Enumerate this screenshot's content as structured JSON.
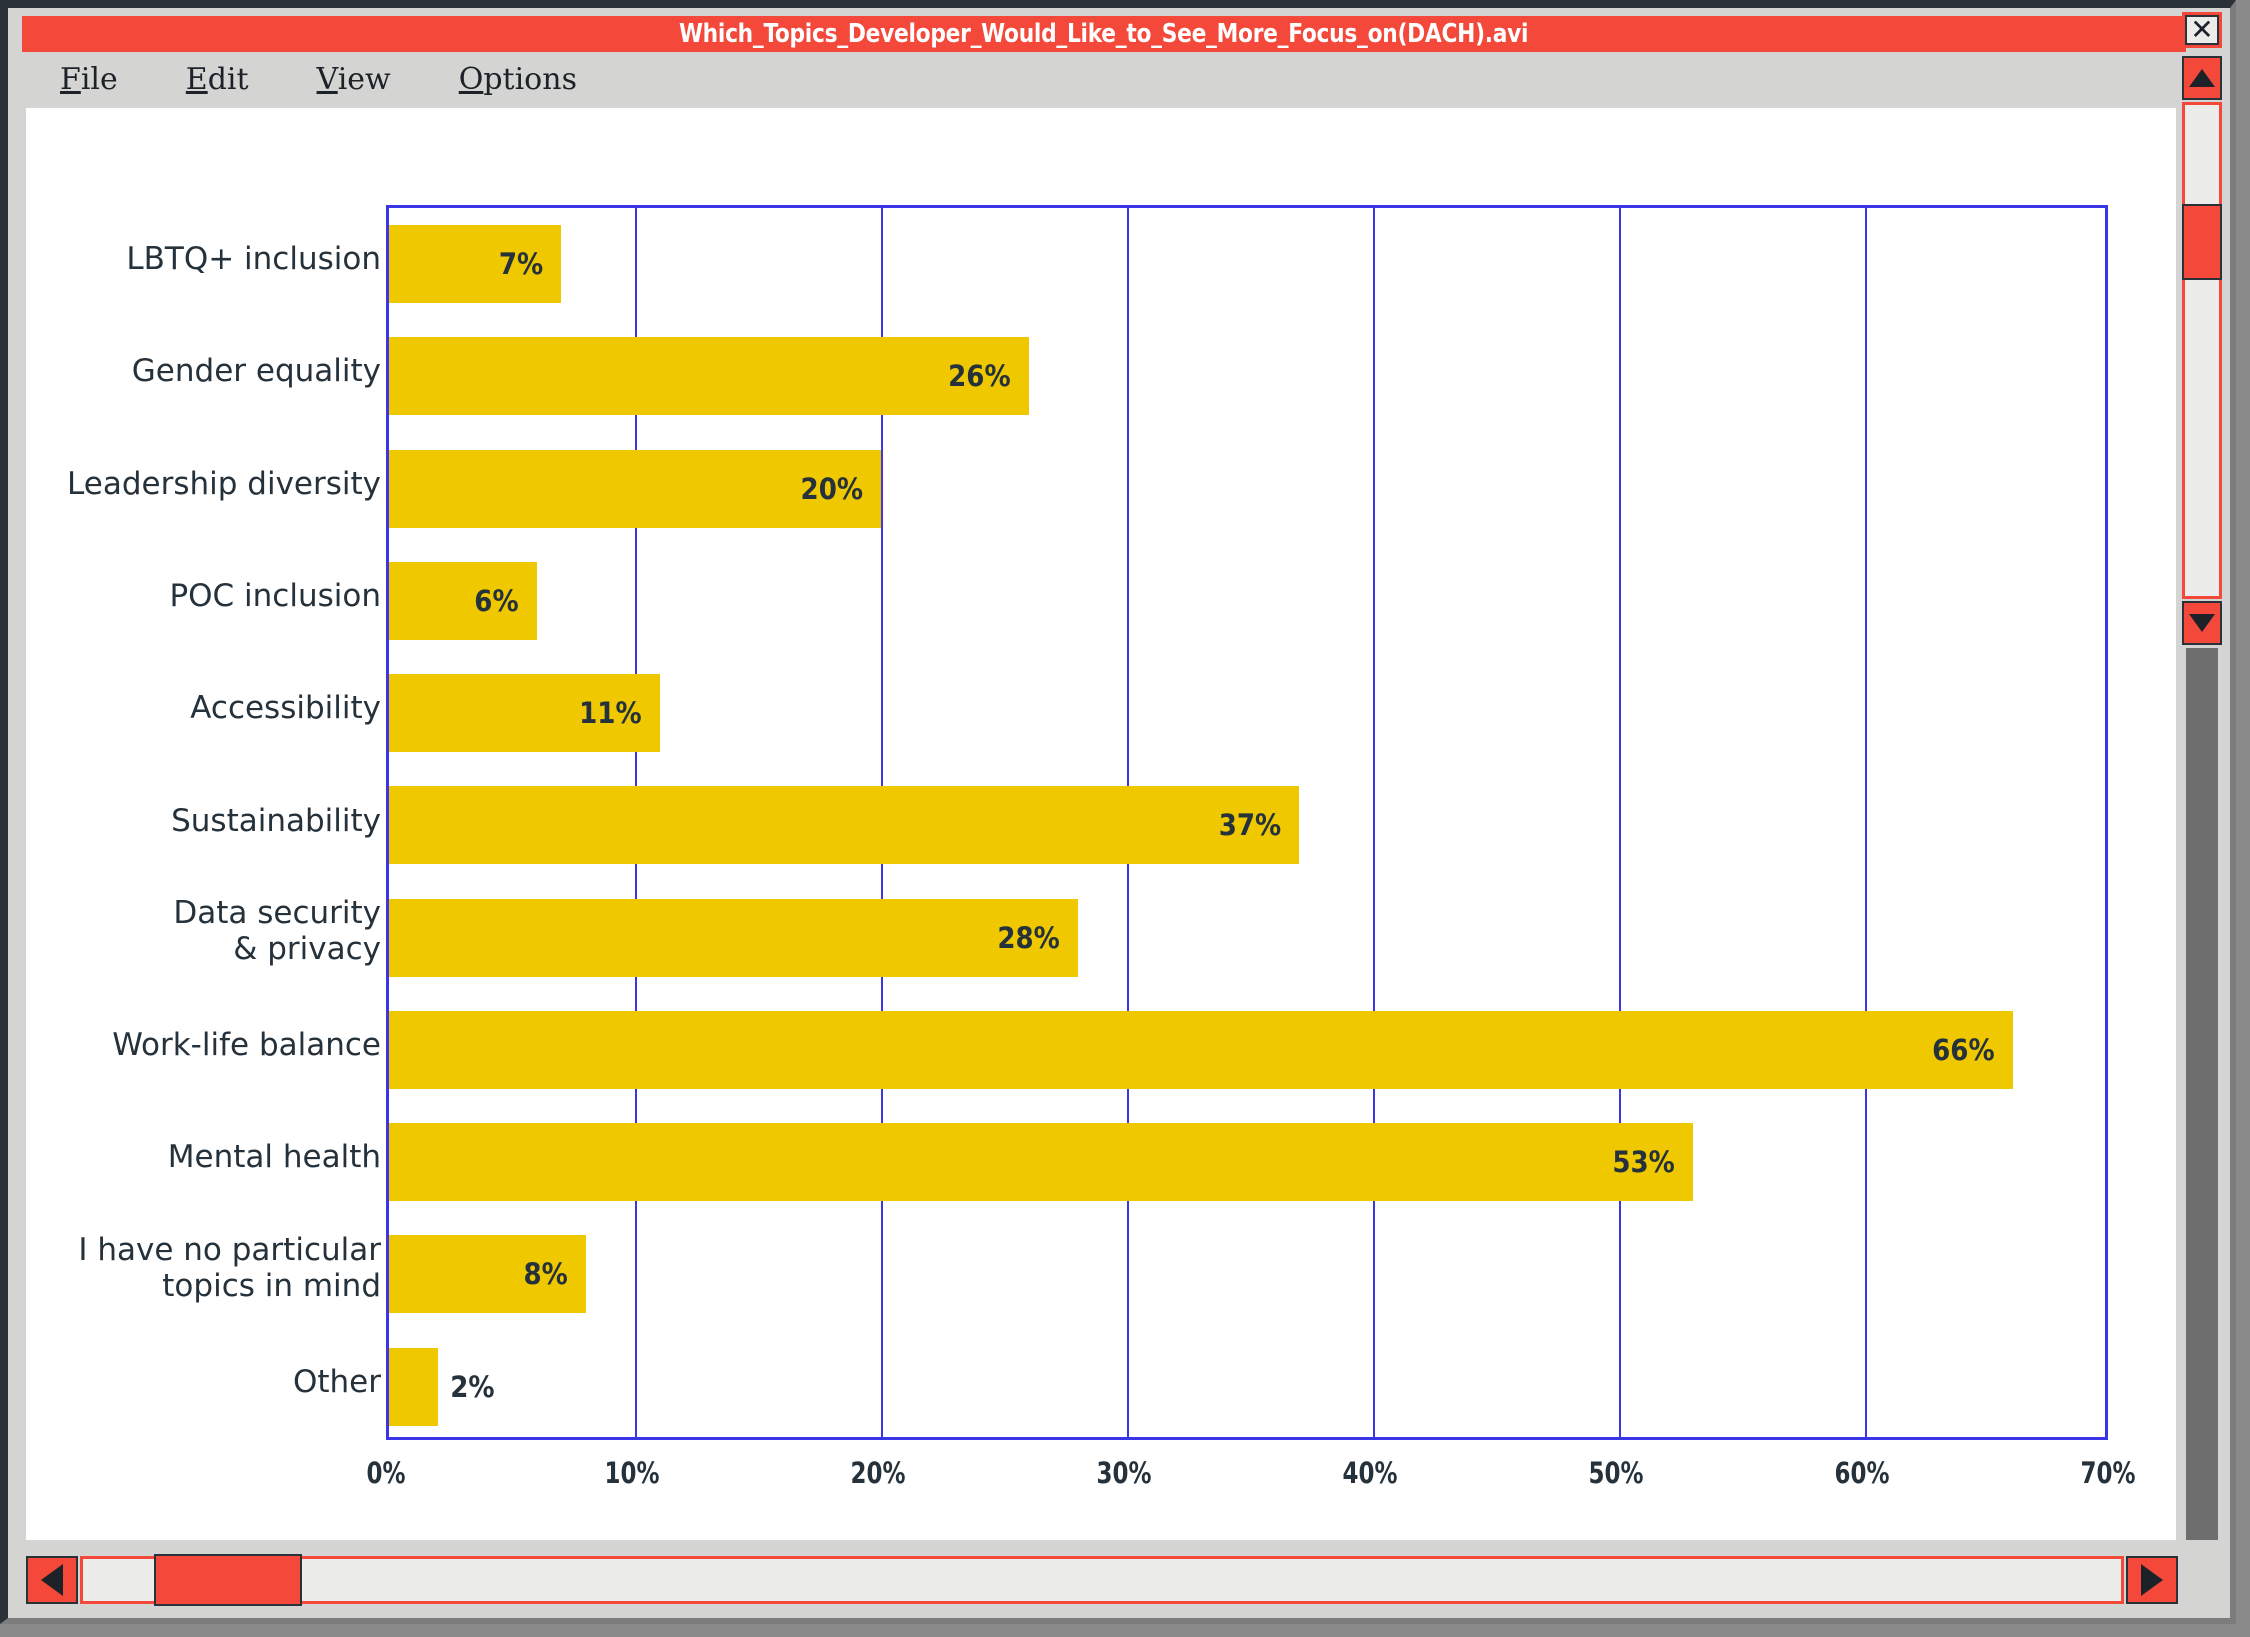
{
  "window": {
    "title": "Which_Topics_Developer_Would_Like_to_See_More_Focus_on(DACH).avi",
    "close_label": "✕"
  },
  "menubar": {
    "items": [
      {
        "accel": "F",
        "rest": "ile"
      },
      {
        "accel": "E",
        "rest": "dit"
      },
      {
        "accel": "V",
        "rest": "iew"
      },
      {
        "accel": "O",
        "rest": "ptions"
      }
    ]
  },
  "colors": {
    "bar": "#efc800",
    "axis": "#3b35e8",
    "titlebar": "#f4483a",
    "text": "#26323b",
    "chrome": "#d4d4d2"
  },
  "scrollbars": {
    "vertical": {
      "up_arrow": "▲",
      "down_arrow": "▼"
    },
    "horizontal": {
      "left_arrow": "◀",
      "right_arrow": "▶"
    }
  },
  "chart_data": {
    "type": "bar",
    "orientation": "horizontal",
    "title": "",
    "xlabel": "",
    "ylabel": "",
    "xlim": [
      0,
      70
    ],
    "grid": true,
    "legend": "none",
    "xticks": [
      "0%",
      "10%",
      "20%",
      "30%",
      "40%",
      "50%",
      "60%",
      "70%"
    ],
    "xtick_values": [
      0,
      10,
      20,
      30,
      40,
      50,
      60,
      70
    ],
    "categories": [
      "LBTQ+ inclusion",
      "Gender equality",
      "Leadership diversity",
      "POC inclusion",
      "Accessibility",
      "Sustainability",
      "Data security\n& privacy",
      "Work-life balance",
      "Mental health",
      "I have no particular\ntopics in mind",
      "Other"
    ],
    "values": [
      7,
      26,
      20,
      6,
      11,
      37,
      28,
      66,
      53,
      8,
      2
    ],
    "value_labels": [
      "7%",
      "26%",
      "20%",
      "6%",
      "11%",
      "37%",
      "28%",
      "66%",
      "53%",
      "8%",
      "2%"
    ]
  }
}
